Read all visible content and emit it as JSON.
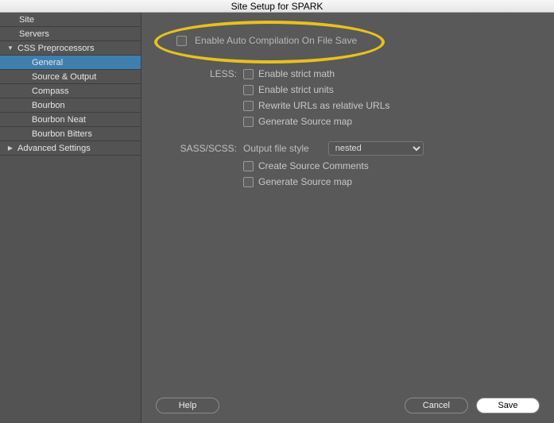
{
  "title": "Site Setup for SPARK",
  "sidebar": {
    "items": [
      {
        "label": "Site"
      },
      {
        "label": "Servers"
      },
      {
        "label": "CSS Preprocessors"
      },
      {
        "label": "General"
      },
      {
        "label": "Source & Output"
      },
      {
        "label": "Compass"
      },
      {
        "label": "Bourbon"
      },
      {
        "label": "Bourbon Neat"
      },
      {
        "label": "Bourbon Bitters"
      },
      {
        "label": "Advanced Settings"
      }
    ]
  },
  "main": {
    "enable_auto": "Enable Auto Compilation On File Save",
    "less_label": "LESS:",
    "less_opts": {
      "strict_math": "Enable strict math",
      "strict_units": "Enable strict units",
      "rewrite_urls": "Rewrite URLs as relative URLs",
      "source_map": "Generate Source map"
    },
    "sass_label": "SASS/SCSS:",
    "sass": {
      "output_style_label": "Output file style",
      "output_style_value": "nested",
      "create_comments": "Create Source Comments",
      "source_map": "Generate Source map"
    }
  },
  "footer": {
    "help": "Help",
    "cancel": "Cancel",
    "save": "Save"
  }
}
